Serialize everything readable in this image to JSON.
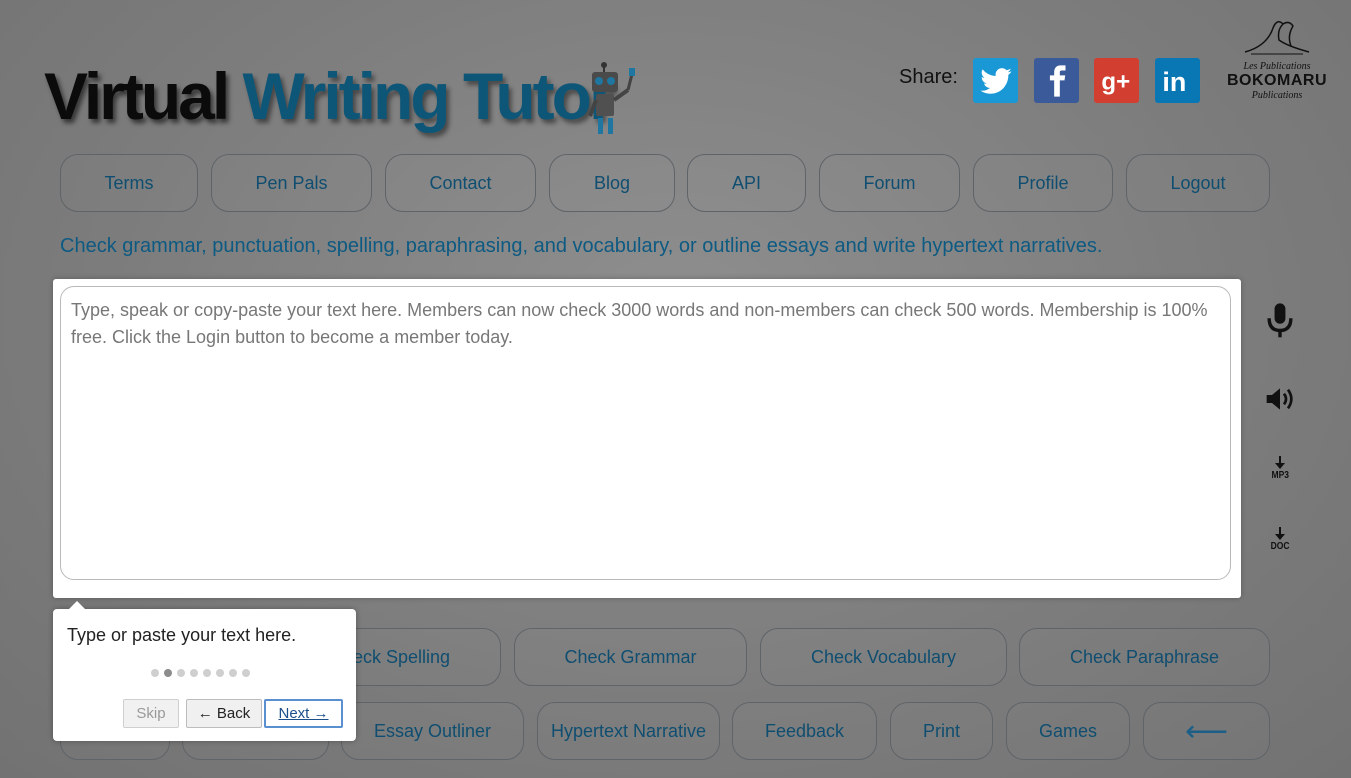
{
  "logo": {
    "word1": "Virtual",
    "word2": "Writing Tutor"
  },
  "share": {
    "label": "Share:",
    "icons": [
      {
        "name": "twitter-icon",
        "color": "#1a97d5"
      },
      {
        "name": "facebook-icon",
        "color": "#3b5a9a"
      },
      {
        "name": "google-plus-icon",
        "color": "#d23f31"
      },
      {
        "name": "linkedin-icon",
        "color": "#0a77b5"
      }
    ]
  },
  "publisher": {
    "line1": "Les Publications",
    "line2": "BOKOMARU",
    "line3": "Publications"
  },
  "nav": [
    "Terms",
    "Pen Pals",
    "Contact",
    "Blog",
    "API",
    "Forum",
    "Profile",
    "Logout"
  ],
  "tagline": "Check grammar, punctuation, spelling, paraphrasing, and vocabulary, or outline essays and write hypertext narratives.",
  "editor": {
    "placeholder": "Type, speak or copy-paste your text here. Members can now check 3000 words and non-members can check 500 words. Membership is 100% free. Click the Login button to become a member today."
  },
  "side_tools": [
    {
      "name": "microphone-icon"
    },
    {
      "name": "speaker-icon"
    },
    {
      "name": "download-mp3-icon",
      "label": "MP3"
    },
    {
      "name": "download-doc-icon",
      "label": "DOC"
    }
  ],
  "actions_row1": [
    "eck Spelling",
    "Check Grammar",
    "Check Vocabulary",
    "Check Paraphrase"
  ],
  "actions_row2": [
    "Essay Outliner",
    "Hypertext Narrative",
    "Feedback",
    "Print",
    "Games"
  ],
  "arrow_button": {
    "icon": "left-arrow-icon",
    "glyph": "⟵"
  },
  "tour": {
    "text": "Type or paste your text here.",
    "step": 2,
    "total_steps": 8,
    "skip": "Skip",
    "back": "← Back",
    "next": "Next →"
  },
  "colors": {
    "accent": "#0f4e70",
    "tagline": "#0d5a82"
  }
}
